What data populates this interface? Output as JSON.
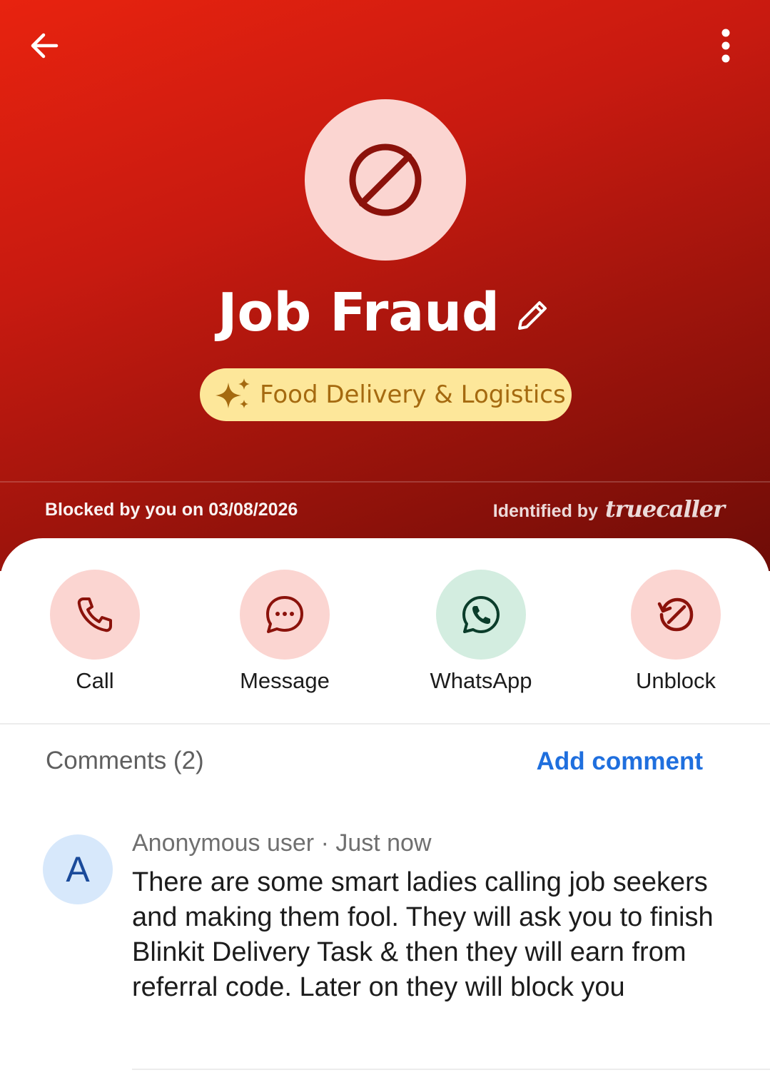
{
  "header": {
    "name": "Job Fraud",
    "tag": "Food Delivery & Logistics",
    "blocked_text": "Blocked by you on 03/08/2026",
    "identified_label": "Identified by",
    "brand": "truecaller",
    "colors": {
      "primary_red": "#e8230f",
      "dark_red": "#6e0c07",
      "avatar_bg": "#fbd5d1",
      "tag_bg": "#fde79a",
      "tag_text": "#a56a10"
    }
  },
  "actions": [
    {
      "label": "Call",
      "icon": "phone-icon"
    },
    {
      "label": "Message",
      "icon": "chat-bubble-icon"
    },
    {
      "label": "WhatsApp",
      "icon": "whatsapp-icon"
    },
    {
      "label": "Unblock",
      "icon": "unblock-icon"
    }
  ],
  "comments": {
    "title": "Comments (2)",
    "add_label": "Add comment",
    "items": [
      {
        "avatar_letter": "A",
        "meta": "Anonymous user · Just now",
        "text": "There are some smart ladies calling job seekers and making them fool. They will ask you to finish Blinkit Delivery Task & then they will earn from referral code. Later on they will block you"
      }
    ]
  }
}
